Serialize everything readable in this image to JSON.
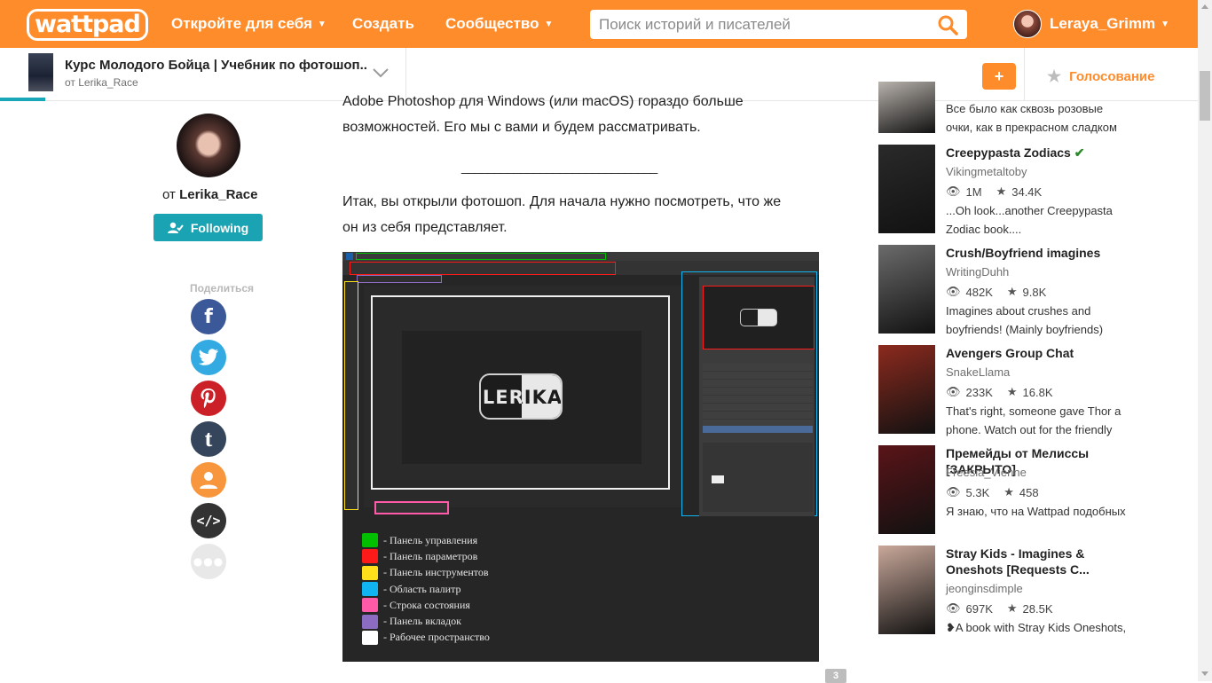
{
  "header": {
    "logo": "wattpad",
    "nav": [
      "Откройте для себя",
      "Создать",
      "Сообщество"
    ],
    "search_placeholder": "Поиск историй и писателей",
    "username": "Leraya_Grimm"
  },
  "story_bar": {
    "title": "Курс Молодого Бойца | Учебник по фотошоп...",
    "author": "от Lerika_Race",
    "add_label": "+",
    "vote_label": "Голосование",
    "read_progress": 0.038
  },
  "author": {
    "prefix": "от ",
    "name": "Lerika_Race",
    "follow_label": "Following"
  },
  "share": {
    "label": "Поделиться",
    "items": [
      {
        "name": "facebook",
        "glyph": "f",
        "color": "#3b5998"
      },
      {
        "name": "twitter",
        "glyph": "t",
        "color": "#33aae1"
      },
      {
        "name": "pinterest",
        "glyph": "p",
        "color": "#cb2027"
      },
      {
        "name": "tumblr",
        "glyph": "t",
        "color": "#35465c"
      },
      {
        "name": "user",
        "glyph": "u",
        "color": "#f7963c"
      },
      {
        "name": "embed",
        "glyph": "</>",
        "color": "#333333"
      },
      {
        "name": "more",
        "glyph": "•••",
        "color": "#e8e8e8"
      }
    ]
  },
  "content": {
    "para1_line1": "Adobe Photoshop для Windows (или macOS) гораздо больше",
    "para1_line2": "возможностей. Его мы с вами и будем рассматривать.",
    "separator": "______________________________",
    "para2_line1": "Итак, вы открыли фотошоп. Для начала нужно посмотреть, что же",
    "para2_line2": "он из себя представляет.",
    "image_logo": "LERIKA",
    "legend": [
      {
        "color": "#00c000",
        "label": "- Панель управления"
      },
      {
        "color": "#ff1a1a",
        "label": "- Панель параметров"
      },
      {
        "color": "#ffe01a",
        "label": "- Панель инструментов"
      },
      {
        "color": "#10b4f0",
        "label": "- Область палитр"
      },
      {
        "color": "#ff5aa8",
        "label": "- Строка состояния"
      },
      {
        "color": "#8b6cc0",
        "label": "- Панель вкладок"
      },
      {
        "color": "#ffffff",
        "label": "- Рабочее пространство"
      }
    ],
    "page_badge": "3"
  },
  "recommendations": [
    {
      "title": "",
      "author": "",
      "views": "",
      "votes": "",
      "desc": "Все было как сквозь розовые очки, как в прекрасном сладком",
      "cover_color": "#b9b3ad"
    },
    {
      "title": "Creepypasta Zodiacs",
      "verified": true,
      "author": "Vikingmetaltoby",
      "views": "1M",
      "votes": "34.4K",
      "desc": "...Oh look...another Creepypasta Zodiac book....",
      "cover_color": "#2a2a2a"
    },
    {
      "title": "Crush/Boyfriend imagines",
      "author": "WritingDuhh",
      "views": "482K",
      "votes": "9.8K",
      "desc": "Imagines about crushes and boyfriends! (Mainly boyfriends)",
      "cover_color": "#6b6b6b"
    },
    {
      "title": "Avengers Group Chat",
      "author": "SnakeLlama",
      "views": "233K",
      "votes": "16.8K",
      "desc": "That's right, someone gave Thor a phone. Watch out for the friendly",
      "cover_color": "#8c2a1e"
    },
    {
      "title": "Премейды от Мелиссы [ЗАКРЫТО]",
      "author": "Freesia_Vienne",
      "views": "5.3K",
      "votes": "458",
      "desc": "Я знаю, что на Wattpad подобных",
      "cover_color": "#5a1418"
    },
    {
      "title": "Stray Kids - Imagines & Oneshots [Requests C...",
      "author": "jeonginsdimple",
      "views": "697K",
      "votes": "28.5K",
      "desc": "❥A book with Stray Kids Oneshots,",
      "cover_color": "#c9a89a"
    }
  ]
}
